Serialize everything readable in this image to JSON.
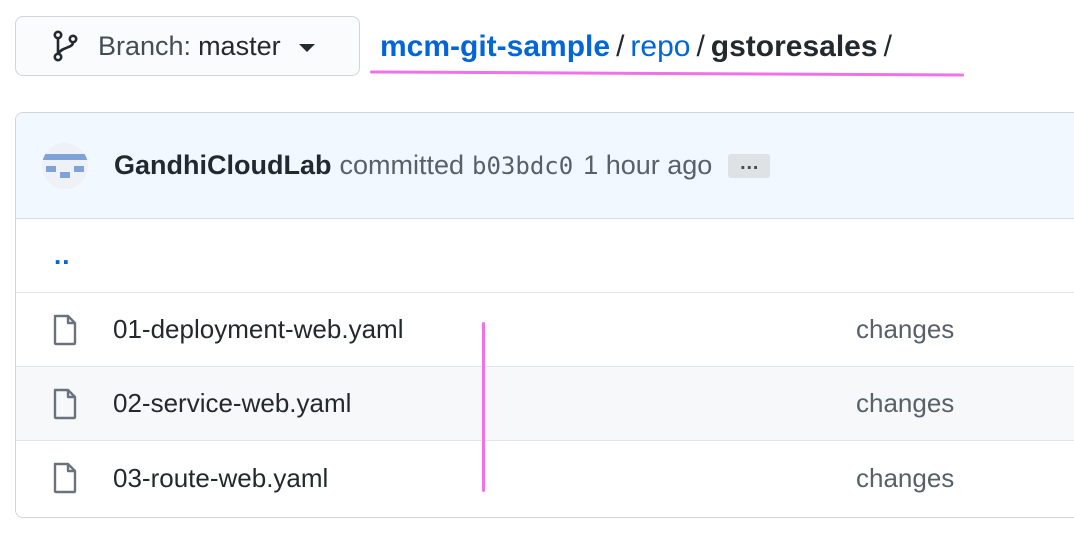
{
  "branch": {
    "prefix": "Branch:",
    "name": "master",
    "icon": "git-branch-icon"
  },
  "breadcrumb": {
    "repo_root": "mcm-git-sample",
    "folder": "repo",
    "current": "gstoresales",
    "separator": "/"
  },
  "commit": {
    "avatar_icon": "avatar-identicon",
    "author": "GandhiCloudLab",
    "verb": "committed",
    "sha": "b03bdc0",
    "time": "1 hour ago",
    "ellipsis": "…"
  },
  "parent_link": "..",
  "files": [
    {
      "name": "01-deployment-web.yaml",
      "message": "changes",
      "icon": "file-icon"
    },
    {
      "name": "02-service-web.yaml",
      "message": "changes",
      "icon": "file-icon"
    },
    {
      "name": "03-route-web.yaml",
      "message": "changes",
      "icon": "file-icon"
    }
  ],
  "colors": {
    "link": "#0366d6",
    "annotation": "#f071e8",
    "commit_bg": "#f1f8ff"
  }
}
